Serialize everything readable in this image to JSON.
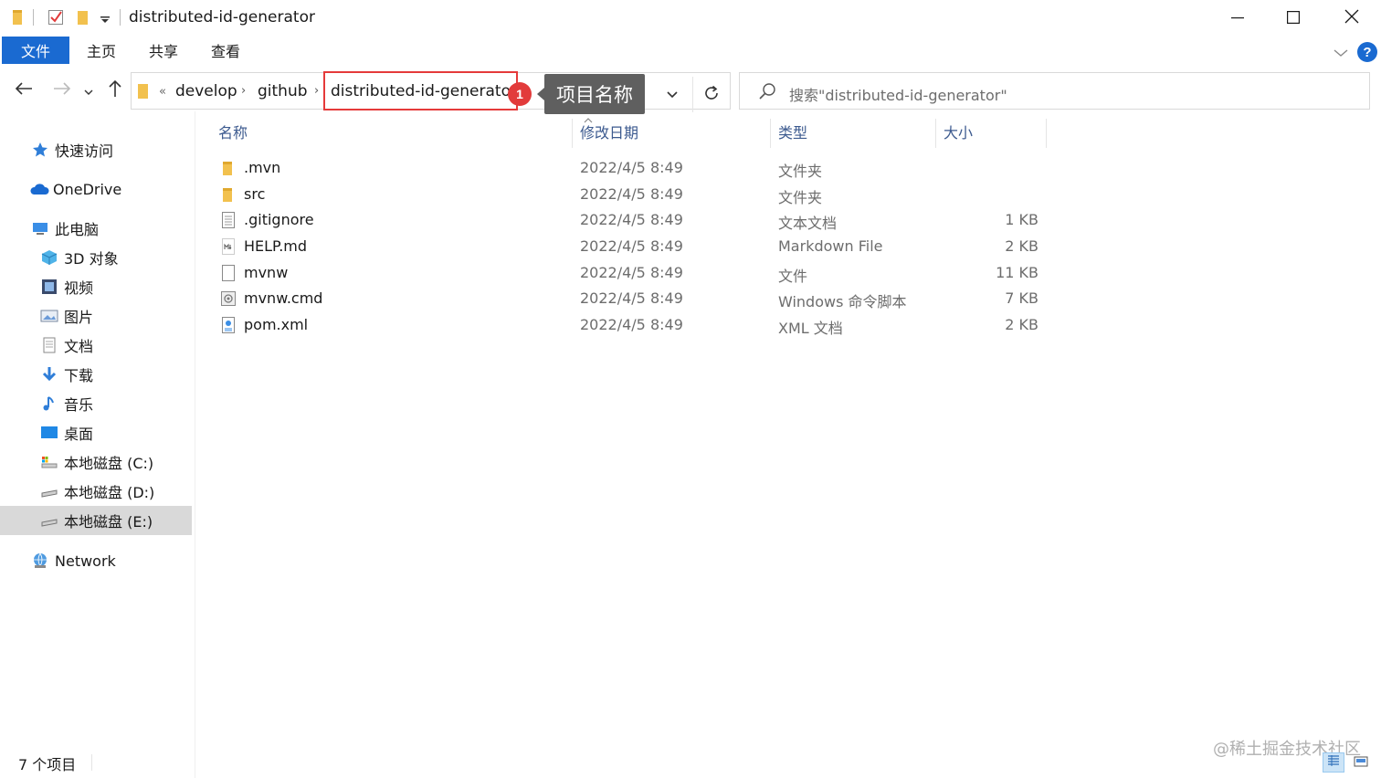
{
  "window": {
    "title": "distributed-id-generator",
    "icons": [
      "folder-icon",
      "properties-check-icon",
      "new-folder-icon",
      "customize-qat-icon"
    ],
    "controls": [
      "minimize-icon",
      "maximize-icon",
      "close-icon"
    ]
  },
  "ribbon": {
    "tabs": [
      {
        "label": "文件",
        "active": true
      },
      {
        "label": "主页"
      },
      {
        "label": "共享"
      },
      {
        "label": "查看"
      }
    ],
    "help": "?"
  },
  "nav": {
    "back": "←",
    "forward": "→",
    "recent": "˅",
    "up": "↑"
  },
  "address": {
    "overflow": "«",
    "crumbs": [
      "develop",
      "github",
      "distributed-id-generator"
    ],
    "separator": "›"
  },
  "annotation": {
    "badge": "1",
    "label": "项目名称"
  },
  "search": {
    "placeholder": "搜索\"distributed-id-generator\""
  },
  "sidebar": {
    "items": [
      {
        "label": "快速访问",
        "icon": "quick-access-star-icon"
      },
      {
        "label": "OneDrive",
        "icon": "onedrive-cloud-icon"
      },
      {
        "label": "此电脑",
        "icon": "this-pc-icon"
      },
      {
        "label": "3D 对象",
        "icon": "3d-objects-icon"
      },
      {
        "label": "视频",
        "icon": "videos-icon"
      },
      {
        "label": "图片",
        "icon": "pictures-icon"
      },
      {
        "label": "文档",
        "icon": "documents-icon"
      },
      {
        "label": "下载",
        "icon": "downloads-icon"
      },
      {
        "label": "音乐",
        "icon": "music-icon"
      },
      {
        "label": "桌面",
        "icon": "desktop-icon"
      },
      {
        "label": "本地磁盘 (C:)",
        "icon": "drive-c-icon"
      },
      {
        "label": "本地磁盘 (D:)",
        "icon": "drive-d-icon"
      },
      {
        "label": "本地磁盘 (E:)",
        "icon": "drive-e-icon",
        "selected": true
      },
      {
        "label": "Network",
        "icon": "network-icon"
      }
    ]
  },
  "columns": {
    "name": "名称",
    "modified": "修改日期",
    "type": "类型",
    "size": "大小"
  },
  "files": [
    {
      "name": ".mvn",
      "modified": "2022/4/5 8:49",
      "type": "文件夹",
      "size": "",
      "icon": "folder-icon"
    },
    {
      "name": "src",
      "modified": "2022/4/5 8:49",
      "type": "文件夹",
      "size": "",
      "icon": "folder-icon"
    },
    {
      "name": ".gitignore",
      "modified": "2022/4/5 8:49",
      "type": "文本文档",
      "size": "1 KB",
      "icon": "text-file-icon"
    },
    {
      "name": "HELP.md",
      "modified": "2022/4/5 8:49",
      "type": "Markdown File",
      "size": "2 KB",
      "icon": "markdown-file-icon"
    },
    {
      "name": "mvnw",
      "modified": "2022/4/5 8:49",
      "type": "文件",
      "size": "11 KB",
      "icon": "blank-file-icon"
    },
    {
      "name": "mvnw.cmd",
      "modified": "2022/4/5 8:49",
      "type": "Windows 命令脚本",
      "size": "7 KB",
      "icon": "cmd-script-icon"
    },
    {
      "name": "pom.xml",
      "modified": "2022/4/5 8:49",
      "type": "XML 文档",
      "size": "2 KB",
      "icon": "xml-file-icon"
    }
  ],
  "status": {
    "count": "7 个项目",
    "watermark": "@稀土掘金技术社区"
  },
  "colors": {
    "accent": "#1a6ad1",
    "annotation_red": "#e23b3b",
    "callout_bg": "#5f5f5f",
    "selected_bg": "#d9d9d9",
    "header_text": "#3c5a8f"
  }
}
